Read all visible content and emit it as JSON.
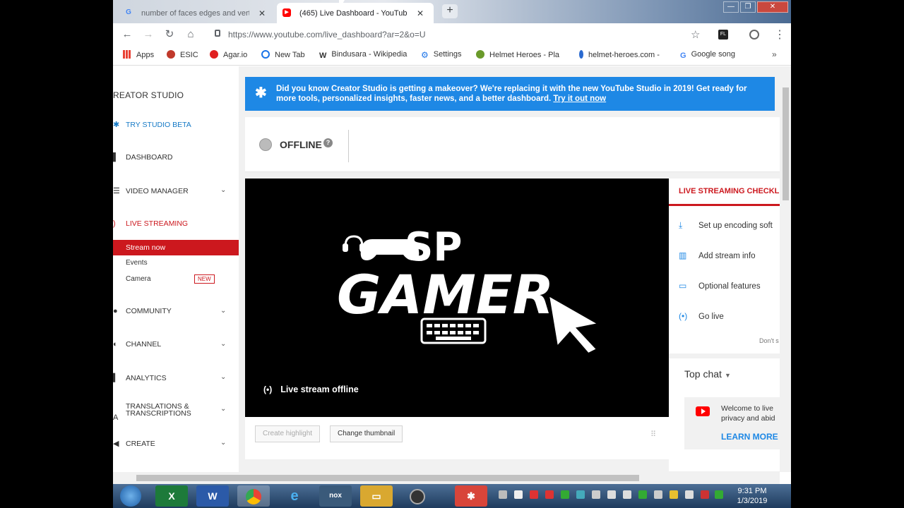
{
  "browser": {
    "tabs": [
      {
        "title": "number of faces edges and verti",
        "active": false
      },
      {
        "title": "(465) Live Dashboard - YouTube",
        "active": true
      }
    ],
    "url": "https://www.youtube.com/live_dashboard?ar=2&o=U",
    "bookmarks": [
      {
        "label": "Apps",
        "color": "#e94235"
      },
      {
        "label": "ESIC",
        "color": "#c0392b"
      },
      {
        "label": "Agar.io",
        "color": "#e02020"
      },
      {
        "label": "New Tab",
        "color": "#1a73e8"
      },
      {
        "label": "Bindusara - Wikipedia",
        "color": "#444444"
      },
      {
        "label": "Settings",
        "color": "#1a73e8"
      },
      {
        "label": "Helmet Heroes - Pla",
        "color": "#6a9a2a"
      },
      {
        "label": "helmet-heroes.com -",
        "color": "#2a6ad0"
      },
      {
        "label": "Google song",
        "color": "#4285f4"
      }
    ],
    "more": "»"
  },
  "sidebar": {
    "title": "REATOR STUDIO",
    "try_beta": "TRY STUDIO BETA",
    "dashboard": "DASHBOARD",
    "video_manager": "VIDEO MANAGER",
    "live_streaming": "LIVE STREAMING",
    "stream_now": "Stream now",
    "events": "Events",
    "camera": "Camera",
    "new_badge": "NEW",
    "community": "COMMUNITY",
    "channel": "CHANNEL",
    "analytics": "ANALYTICS",
    "translations_1": "TRANSLATIONS &",
    "translations_2": "TRANSCRIPTIONS",
    "create": "CREATE"
  },
  "banner": {
    "text": "Did you know Creator Studio is getting a makeover? We're replacing it with the new YouTube Studio in 2019! Get ready for more tools, personalized insights, faster news, and a better dashboard.",
    "link": "Try it out now"
  },
  "status": {
    "label": "OFFLINE",
    "help": "?"
  },
  "video": {
    "logo_top": "SP",
    "logo_main": "GAMER",
    "offline_text": "Live stream offline"
  },
  "actions": {
    "create_highlight": "Create highlight",
    "change_thumbnail": "Change thumbnail"
  },
  "checklist": {
    "title": "LIVE STREAMING CHECKL",
    "items": [
      {
        "label": "Set up encoding soft",
        "icon": "download-icon"
      },
      {
        "label": "Add stream info",
        "icon": "chart-icon"
      },
      {
        "label": "Optional features",
        "icon": "card-icon"
      },
      {
        "label": "Go live",
        "icon": "broadcast-icon"
      }
    ],
    "dont": "Don't s"
  },
  "chat": {
    "title": "Top chat",
    "welcome_1": "Welcome to live",
    "welcome_2": "privacy and abid",
    "learn_more": "LEARN MORE"
  },
  "clock": {
    "time": "9:31 PM",
    "date": "1/3/2019"
  }
}
